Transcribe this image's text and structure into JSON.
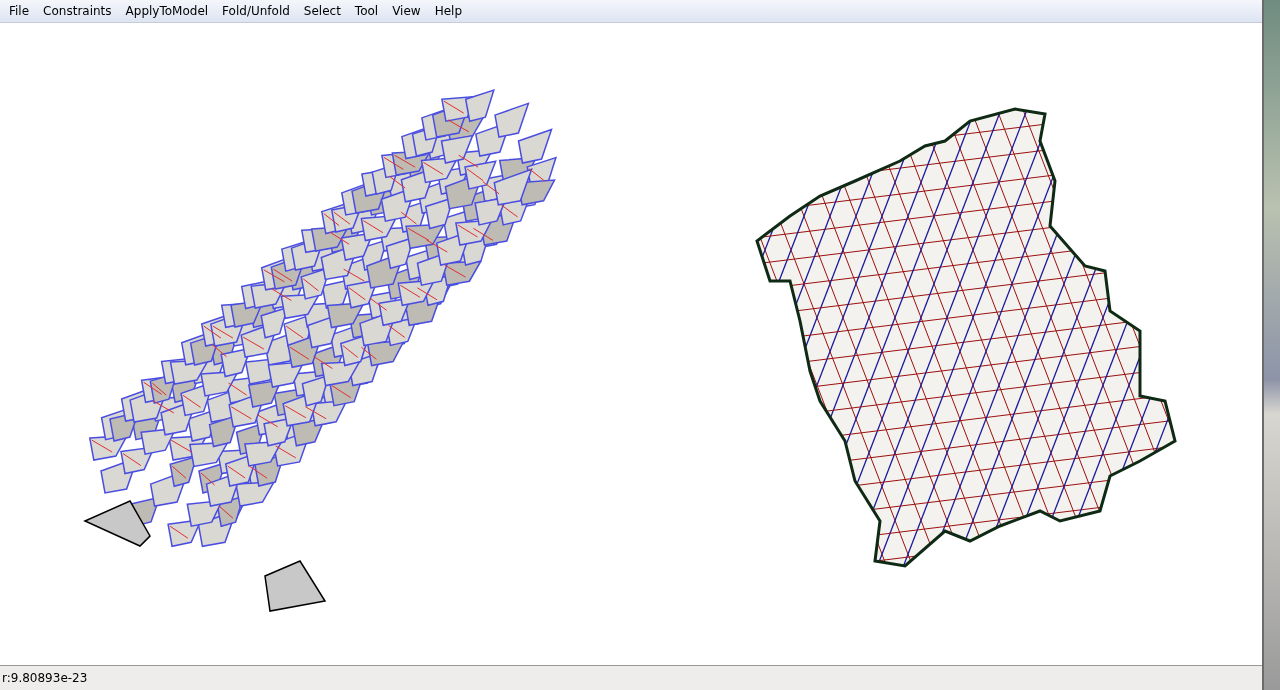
{
  "menu": [
    "File",
    "Constraints",
    "ApplyToModel",
    "Fold/Unfold",
    "Select",
    "Tool",
    "View",
    "Help"
  ],
  "status_bar": {
    "text": "r:9.80893e-23"
  }
}
